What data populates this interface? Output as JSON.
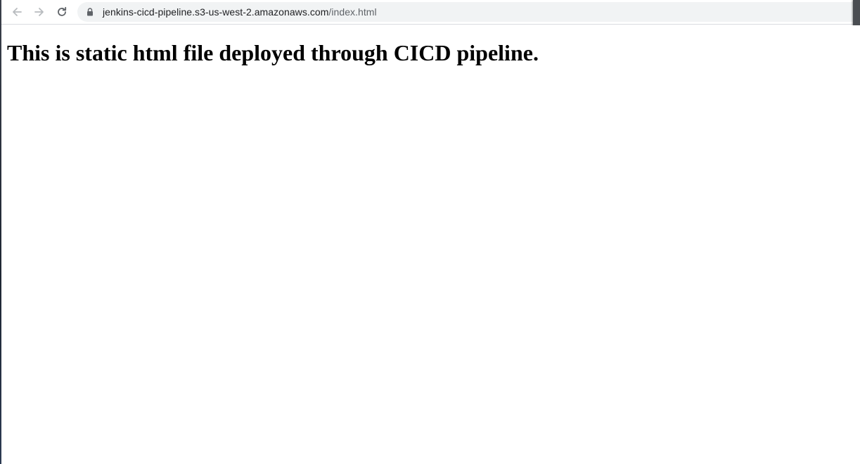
{
  "browser": {
    "url_host": "jenkins-cicd-pipeline.s3-us-west-2.amazonaws.com",
    "url_path": "/index.html",
    "nav_icons": {
      "back": "arrow-left-icon",
      "forward": "arrow-right-icon",
      "reload": "reload-icon",
      "secure": "lock-icon"
    },
    "colors": {
      "toolbar_bg": "#ffffff",
      "omnibox_bg": "#f1f3f4",
      "icon_color": "#5f6368"
    }
  },
  "page": {
    "heading": "This is static html file deployed through CICD pipeline."
  }
}
